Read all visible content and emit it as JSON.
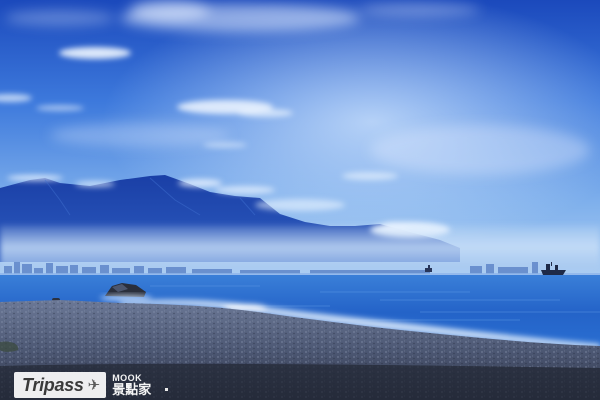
{
  "watermark": {
    "name": "Tripass",
    "icon": "airplane-icon",
    "partner_name": "MOOK",
    "partner_cn": "景點家"
  },
  "colors": {
    "sky_top": "#1e4fc4",
    "sky_mid": "#4d86e2",
    "sky_horizon": "#a9cdf2",
    "mountain": "#163a9c",
    "mist": "#c4dcf5",
    "sea": "#2f73d6",
    "sea_deep": "#1b56c0",
    "beach": "#4e5a78",
    "beach_dark": "#2c3344",
    "surf": "#e6f2ff"
  }
}
